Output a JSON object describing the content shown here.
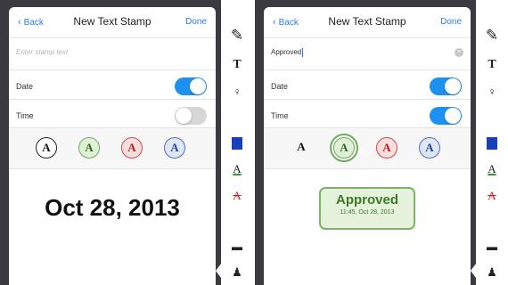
{
  "left": {
    "nav": {
      "back": "Back",
      "title": "New Text Stamp",
      "done": "Done"
    },
    "stamp_text_placeholder": "Enter stamp text",
    "date_label": "Date",
    "time_label": "Time",
    "date_on": true,
    "time_on": false,
    "styles": [
      "A",
      "A",
      "A",
      "A"
    ],
    "preview": "Oct 28, 2013"
  },
  "right": {
    "nav": {
      "back": "Back",
      "title": "New Text Stamp",
      "done": "Done"
    },
    "stamp_text_value": "Approved",
    "clear_icon": "×",
    "date_label": "Date",
    "time_label": "Time",
    "date_on": true,
    "time_on": true,
    "styles": [
      "A",
      "A",
      "A",
      "A"
    ],
    "selected_style": "green",
    "preview_text": "Approved",
    "preview_subtext": "11:45, Oct 28, 2013"
  },
  "toolbar": {
    "icons": [
      "pen-icon",
      "text-icon",
      "note-icon",
      "highlight-icon",
      "underline-icon",
      "strikeout-icon",
      "comment-icon",
      "stamp-icon"
    ],
    "pen": "✎",
    "text": "T",
    "note": "♀",
    "underline": "A",
    "strike": "A",
    "comment": "▬",
    "stamp": "♟"
  },
  "colors": {
    "accent": "#1e90f0",
    "stamp_green": "#7bb466",
    "stamp_red": "#d24a4a",
    "stamp_blue": "#4f6fc8"
  }
}
